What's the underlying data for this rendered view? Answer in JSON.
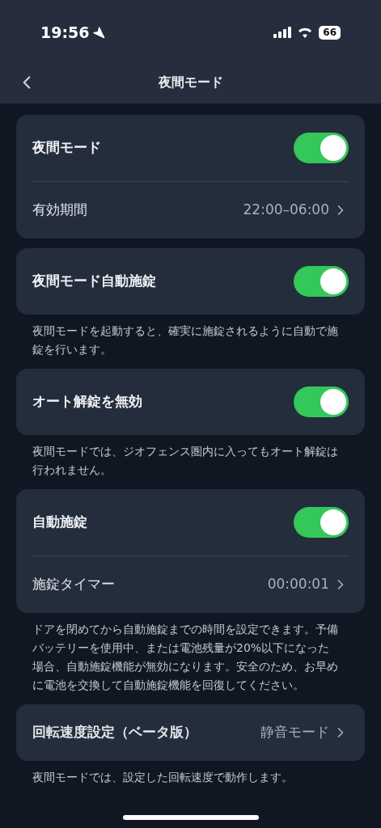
{
  "status_bar": {
    "time": "19:56",
    "battery": "66"
  },
  "nav": {
    "title": "夜間モード"
  },
  "sections": [
    {
      "rows": [
        {
          "kind": "toggle",
          "label": "夜間モード",
          "on": true
        },
        {
          "kind": "link",
          "label": "有効期間",
          "value": "22:00–06:00",
          "bold": false
        }
      ]
    },
    {
      "rows": [
        {
          "kind": "toggle",
          "label": "夜間モード自動施錠",
          "on": true
        }
      ],
      "note": "夜間モードを起動すると、確実に施錠されるように自動で施錠を行います。"
    },
    {
      "rows": [
        {
          "kind": "toggle",
          "label": "オート解錠を無効",
          "on": true
        }
      ],
      "note": "夜間モードでは、ジオフェンス圏内に入ってもオート解錠は行われません。"
    },
    {
      "rows": [
        {
          "kind": "toggle",
          "label": "自動施錠",
          "on": true
        },
        {
          "kind": "link",
          "label": "施錠タイマー",
          "value": "00:00:01",
          "bold": false
        }
      ],
      "note": "ドアを閉めてから自動施錠までの時間を設定できます。予備バッテリーを使用中、または電池残量が20%以下になった場合、自動施錠機能が無効になります。安全のため、お早めに電池を交換して自動施錠機能を回復してください。"
    },
    {
      "rows": [
        {
          "kind": "link",
          "label": "回転速度設定（ベータ版）",
          "value": "静音モード",
          "bold": true
        }
      ],
      "note": "夜間モードでは、設定した回転速度で動作します。"
    }
  ]
}
